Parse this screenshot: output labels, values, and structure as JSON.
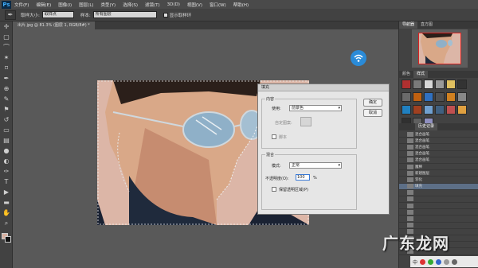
{
  "app": {
    "logo": "Ps",
    "menus": [
      "文件(F)",
      "编辑(E)",
      "图像(I)",
      "图层(L)",
      "类型(Y)",
      "选择(S)",
      "滤镜(T)",
      "3D(D)",
      "视图(V)",
      "窗口(W)",
      "帮助(H)"
    ]
  },
  "options_bar": {
    "brush_label": "取样大小:",
    "brush_value": "取样点",
    "sample_label": "样本:",
    "sample_value": "所有图层",
    "show_ring": "显示取样环"
  },
  "document": {
    "tab_title": "出片.jpg @ 81.3% (图层 1, RGB/8#) *",
    "canvas_color": "#dcb6a7"
  },
  "fill_dialog": {
    "title": "填充",
    "content_group": "内容",
    "use_label": "使用:",
    "use_value": "前景色",
    "custom_pattern_label": "自定图案:",
    "script_label": "脚本",
    "blend_group": "混合",
    "mode_label": "模式:",
    "mode_value": "正常",
    "opacity_label": "不透明度(O):",
    "opacity_value": "100",
    "opacity_unit": "%",
    "preserve_label": "保留透明区域(P)",
    "ok_label": "确定",
    "cancel_label": "取消"
  },
  "right_dock": {
    "navigator_tabs": [
      "导航器",
      "直方图"
    ],
    "styles_tabs": [
      "颜色",
      "样式"
    ],
    "history_tabs": [
      "",
      "历史记录"
    ],
    "history_items": [
      "混合画笔",
      "混合画笔",
      "混合画笔",
      "混合画笔",
      "混合画笔",
      "魔棒",
      "新建图层",
      "羽化",
      "填充",
      "",
      "",
      "",
      "",
      "",
      "",
      "",
      "",
      "",
      ""
    ],
    "history_selected_index": 8,
    "style_colors": [
      "#b03030",
      "#7a7a7a",
      "#d8d8d8",
      "#9a9a9a",
      "#e0c060",
      "#333333",
      "#6a6a6a",
      "#c06010",
      "#3070c0",
      "#505050",
      "#d08020",
      "#888888",
      "#2080c0",
      "#a04020",
      "#70a0d0",
      "#406080",
      "#c05050",
      "#e0a040",
      "#303030",
      "#606060",
      "#9090c0"
    ]
  },
  "watermark": "广东龙网",
  "taskbar": {
    "label": "中",
    "icon_colors": [
      "#d33",
      "#3a3",
      "#36c",
      "#999",
      "#666"
    ]
  },
  "colors": {
    "fg": "#d8b0a0",
    "bg": "#111111",
    "wifi": "#2a8bd8"
  }
}
